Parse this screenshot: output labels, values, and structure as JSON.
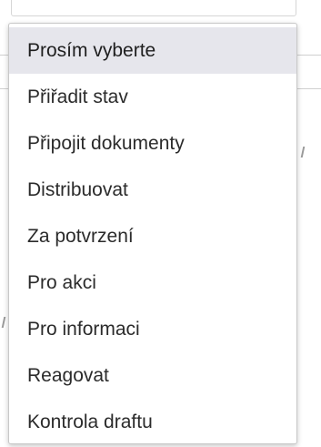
{
  "dropdown": {
    "options": [
      {
        "label": "Prosím vyberte",
        "selected": true
      },
      {
        "label": "Přiřadit stav"
      },
      {
        "label": "Připojit dokumenty"
      },
      {
        "label": "Distribuovat"
      },
      {
        "label": "Za potvrzení"
      },
      {
        "label": "Pro akci"
      },
      {
        "label": "Pro informaci"
      },
      {
        "label": "Reagovat"
      },
      {
        "label": "Kontrola draftu"
      }
    ],
    "highlight_color": "#e6e6ec",
    "text_color": "#2b2b2b"
  }
}
